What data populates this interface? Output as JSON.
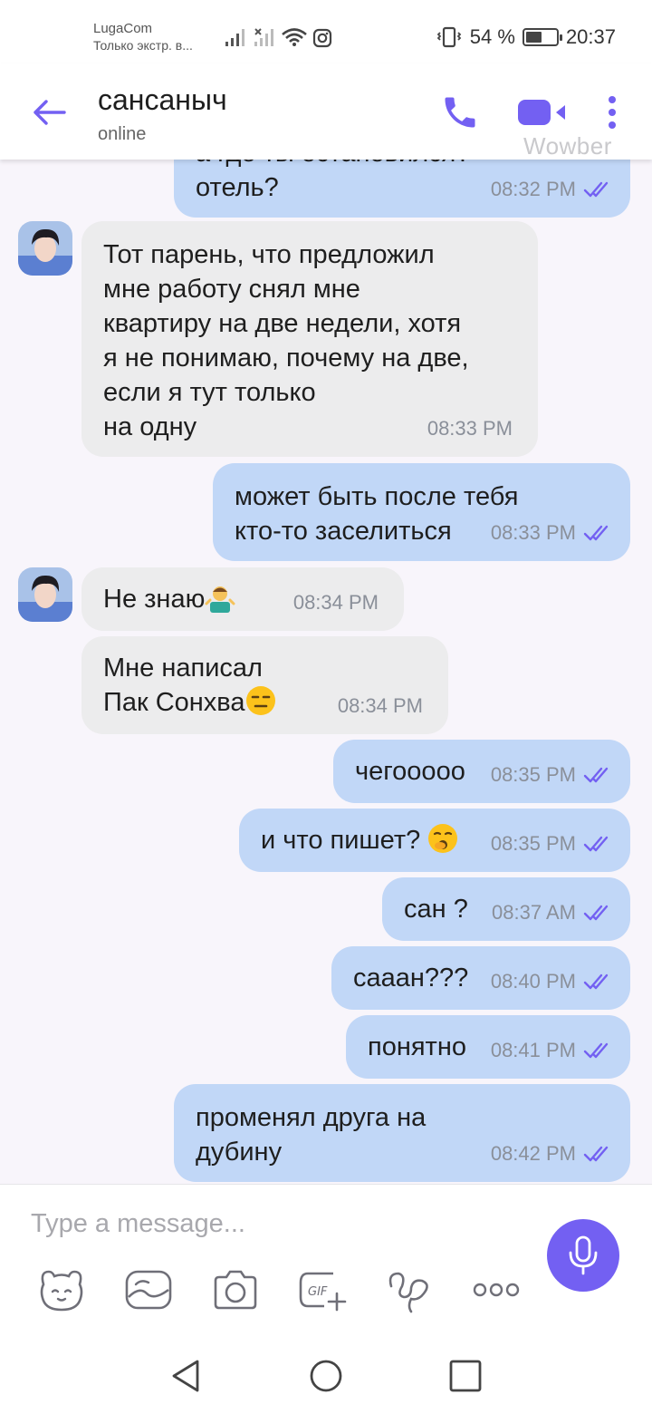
{
  "status_bar": {
    "carrier": "LugaCom",
    "carrier_sub": "Только экстр. в...",
    "battery_text": "54 %",
    "battery_level": 0.54,
    "time": "20:37"
  },
  "header": {
    "contact_name": "сансаныч",
    "contact_status": "online",
    "watermark": "Wowber"
  },
  "colors": {
    "accent": "#7360f2",
    "outgoing_bubble": "#c1d7f7",
    "incoming_bubble": "#ececed",
    "ticks": "#7360f2"
  },
  "messages": [
    {
      "dir": "out",
      "text": "а где ты остановился?\nотель?",
      "time": "08:32 PM",
      "ticks": "read"
    },
    {
      "dir": "in",
      "text": "Тот парень, что предложил\nмне работу снял мне\nквартиру на две недели, хотя\nя не понимаю, почему на две,\nесли я тут только\nна одну",
      "time": "08:33 PM",
      "avatar": true
    },
    {
      "dir": "out",
      "text": "может быть после тебя\nкто-то заселиться",
      "time": "08:33 PM",
      "ticks": "read"
    },
    {
      "dir": "in",
      "text": "Не знаю",
      "emoji": "person-shrugging",
      "time": "08:34 PM",
      "avatar": true
    },
    {
      "dir": "in",
      "text": "Мне написал\nПак Сонхва",
      "emoji": "expressionless-face",
      "time": "08:34 PM"
    },
    {
      "dir": "out",
      "text": "чегооооо",
      "time": "08:35 PM",
      "ticks": "read"
    },
    {
      "dir": "out",
      "text": "и что пишет?",
      "emoji": "yawning-face",
      "time": "08:35 PM",
      "ticks": "read"
    },
    {
      "dir": "out",
      "text": "сан ?",
      "time": "08:37 AM",
      "ticks": "read"
    },
    {
      "dir": "out",
      "text": "сааан???",
      "time": "08:40 PM",
      "ticks": "read"
    },
    {
      "dir": "out",
      "text": "понятно",
      "time": "08:41 PM",
      "ticks": "read"
    },
    {
      "dir": "out",
      "text": "променял друга на\nдубину",
      "time": "08:42 PM",
      "ticks": "read"
    }
  ],
  "composer": {
    "placeholder": "Type a message...",
    "tools": [
      "sticker-icon",
      "photo-gallery-icon",
      "camera-icon",
      "gif-icon",
      "doodle-icon",
      "more-options-icon"
    ],
    "send_icon": "microphone-icon"
  },
  "nav_bar": [
    "back-icon",
    "home-icon",
    "recents-icon"
  ]
}
